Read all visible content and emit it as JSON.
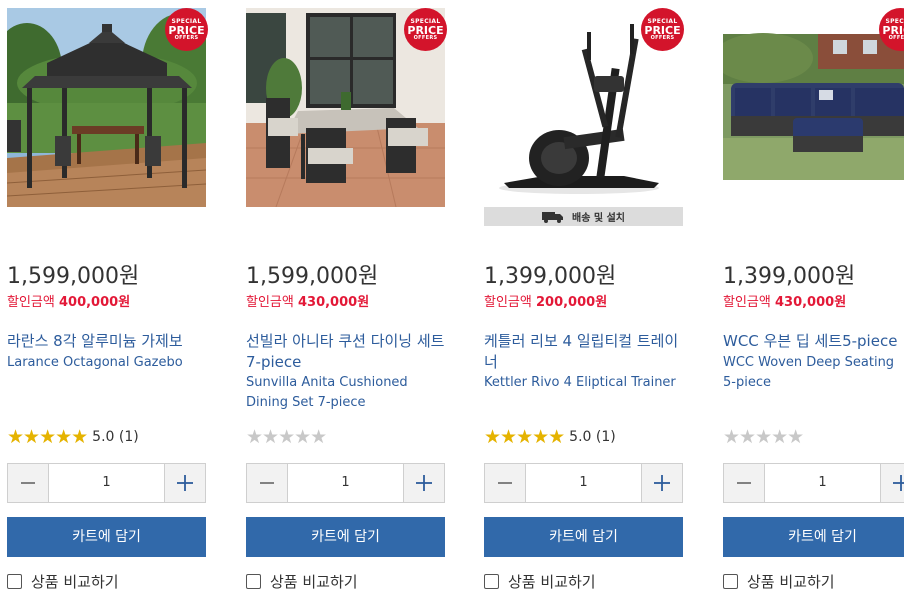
{
  "badge": {
    "line1": "SPECIAL",
    "line2": "PRICE",
    "line3": "OFFERS"
  },
  "products": [
    {
      "price": "1,599,000원",
      "discount_label": "할인금액",
      "discount_value": "400,000원",
      "name_kr": "라란스 8각 알루미늄 가제보",
      "name_en": "Larance Octagonal Gazebo",
      "rating_stars": 5,
      "rating_text": "5.0 (1)",
      "qty": "1",
      "cart_label": "카트에 담기",
      "compare_label": "상품 비교하기"
    },
    {
      "price": "1,599,000원",
      "discount_label": "할인금액",
      "discount_value": "430,000원",
      "name_kr": "선빌라 아니타 쿠션 다이닝 세트7-piece",
      "name_en": "Sunvilla Anita Cushioned Dining Set 7-piece",
      "rating_stars": 0,
      "rating_text": "",
      "qty": "1",
      "cart_label": "카트에 담기",
      "compare_label": "상품 비교하기"
    },
    {
      "price": "1,399,000원",
      "discount_label": "할인금액",
      "discount_value": "200,000원",
      "name_kr": "케틀러 리보 4 일립티컬 트레이너",
      "name_en": "Kettler Rivo 4 Eliptical Trainer",
      "rating_stars": 5,
      "rating_text": "5.0 (1)",
      "qty": "1",
      "cart_label": "카트에 담기",
      "compare_label": "상품 비교하기",
      "image_caption": "배송 및 설치"
    },
    {
      "price": "1,399,000원",
      "discount_label": "할인금액",
      "discount_value": "430,000원",
      "name_kr": "WCC 우븐 딥 세트5-piece",
      "name_en": "WCC Woven Deep Seating 5-piece",
      "rating_stars": 0,
      "rating_text": "",
      "qty": "1",
      "cart_label": "카트에 담기",
      "compare_label": "상품 비교하기"
    }
  ],
  "colors": {
    "price_text": "#333333",
    "discount": "#e31837",
    "product_link": "#2d5c9c",
    "star_filled": "#e5b300",
    "star_empty": "#c8c8c8",
    "cart_button": "#3169aa",
    "badge": "#d3142b"
  }
}
